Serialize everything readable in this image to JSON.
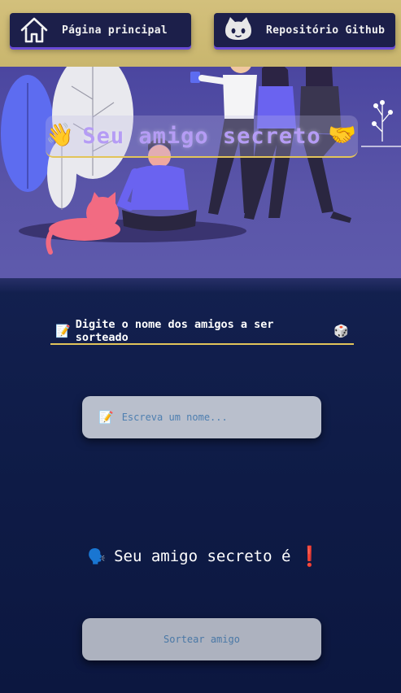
{
  "nav": {
    "home_label": "Página principal",
    "home_icon": "home-icon",
    "github_label": "Repositório Github",
    "github_icon": "github-icon"
  },
  "hero": {
    "title": "Seu amigo secreto",
    "emoji_left": "👋",
    "emoji_right": "🤝"
  },
  "form": {
    "instruction_emoji_left": "📝",
    "instruction": "Digite o nome dos amigos a ser sorteado",
    "instruction_emoji_right": "🎲",
    "input_emoji": "📝",
    "input_placeholder": "Escreva um nome...",
    "input_value": ""
  },
  "result": {
    "emoji": "🗣️",
    "text": "Seu amigo secreto é",
    "mark": "❗"
  },
  "actions": {
    "draw_label": "Sortear amigo"
  },
  "colors": {
    "header_bg": "#d3c07c",
    "nav_bg": "#1c1f4a",
    "accent_purple": "#6a4bd6",
    "hero_bg": "#4b46a0",
    "title_color": "#b59cf5",
    "underline_gold": "#e2c45a",
    "main_bg": "#0e1b46",
    "input_bg": "#b9bfcc",
    "button_bg": "#adb2bf",
    "exclamation_red": "#e02424"
  }
}
